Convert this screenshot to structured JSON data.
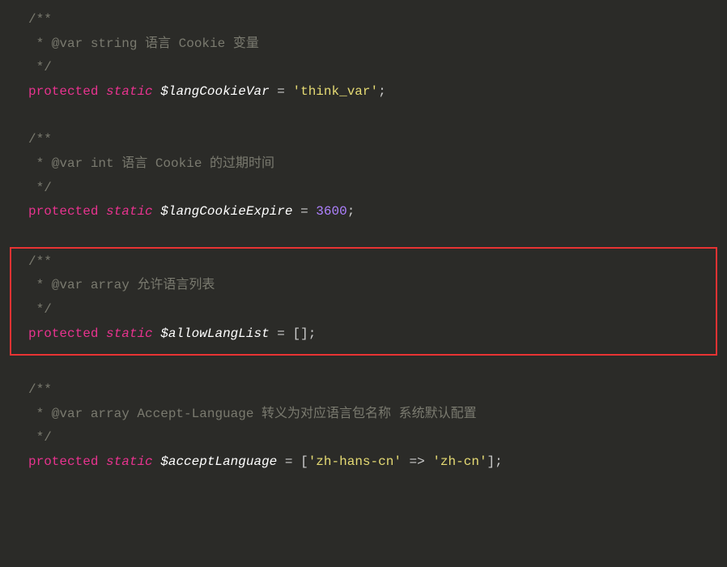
{
  "block1": {
    "open": "/**",
    "tagline": " * @var string 语言 Cookie 变量",
    "close": " */",
    "kw_protected": "protected",
    "kw_static": "static",
    "var": "$langCookieVar",
    "eq": " = ",
    "value": "'think_var'",
    "semi": ";"
  },
  "block2": {
    "open": "/**",
    "tagline": " * @var int 语言 Cookie 的过期时间",
    "close": " */",
    "kw_protected": "protected",
    "kw_static": "static",
    "var": "$langCookieExpire",
    "eq": " = ",
    "value": "3600",
    "semi": ";"
  },
  "block3": {
    "open": "/**",
    "tagline": " * @var array 允许语言列表",
    "close": " */",
    "kw_protected": "protected",
    "kw_static": "static",
    "var": "$allowLangList",
    "eq": " = ",
    "value": "[]",
    "semi": ";"
  },
  "block4": {
    "open": "/**",
    "tagline": " * @var array Accept-Language 转义为对应语言包名称 系统默认配置",
    "close": " */",
    "kw_protected": "protected",
    "kw_static": "static",
    "var": "$acceptLanguage",
    "eq": " = ",
    "lbracket": "[",
    "key": "'zh-hans-cn'",
    "arrow": " => ",
    "val": "'zh-cn'",
    "rbracket": "]",
    "semi": ";"
  }
}
